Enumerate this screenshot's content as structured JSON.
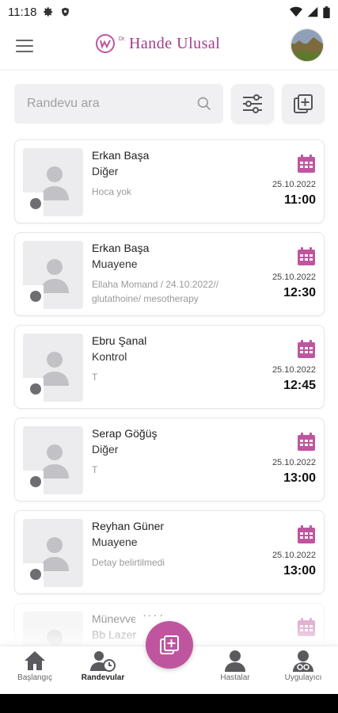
{
  "status_bar": {
    "time": "11:18"
  },
  "header": {
    "logo_text": "Hande Ulusal",
    "logo_prefix": "Dr."
  },
  "search": {
    "placeholder": "Randevu ara",
    "value": ""
  },
  "colors": {
    "accent": "#c0559f",
    "brand": "#a33d8a"
  },
  "appointments": [
    {
      "name": "Erkan Başa",
      "type": "Diğer",
      "note": "Hoca yok",
      "date": "25.10.2022",
      "time": "11:00"
    },
    {
      "name": "Erkan Başa",
      "type": "Muayene",
      "note": "Ellaha Momand / 24.10.2022// glutathoine/ mesotherapy",
      "date": "25.10.2022",
      "time": "12:30"
    },
    {
      "name": "Ebru Şanal",
      "type": "Kontrol",
      "note": "T",
      "date": "25.10.2022",
      "time": "12:45"
    },
    {
      "name": "Serap Göğüş",
      "type": "Diğer",
      "note": "T",
      "date": "25.10.2022",
      "time": "13:00"
    },
    {
      "name": "Reyhan Güner",
      "type": "Muayene",
      "note": "Detay belirtilmedi",
      "date": "25.10.2022",
      "time": "13:00"
    },
    {
      "name": "Münevver Yıldırım",
      "type": "Bb Lazer",
      "note": "",
      "date": "",
      "time": ""
    }
  ],
  "bottom_nav": [
    {
      "label": "Başlangıç",
      "icon": "home-icon"
    },
    {
      "label": "Randevular",
      "icon": "appointments-icon",
      "active": true
    },
    {
      "label": "Hastalar",
      "icon": "patients-icon"
    },
    {
      "label": "Uygulayıcı",
      "icon": "practitioner-icon"
    }
  ]
}
